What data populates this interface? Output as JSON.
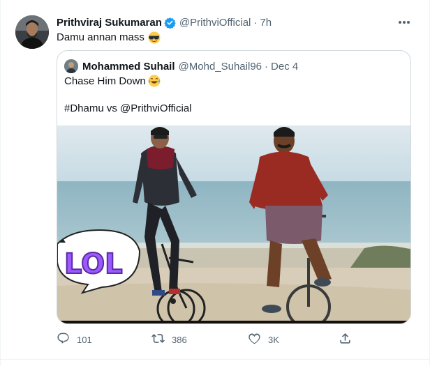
{
  "tweet": {
    "author_name": "Prithviraj Sukumaran",
    "author_handle": "@PrithviOfficial",
    "separator": "·",
    "time": "7h",
    "text": "Damu annan mass"
  },
  "quoted": {
    "author_name": "Mohammed Suhail",
    "author_handle": "@Mohd_Suhail96",
    "separator": "·",
    "time": "Dec 4",
    "text_line1": "Chase Him Down",
    "text_line2": "#Dhamu vs @PrithviOfficial",
    "sticker_text": "LOL"
  },
  "actions": {
    "replies": "101",
    "retweets": "386",
    "likes": "3K"
  },
  "icons": [
    "verified-badge-icon",
    "more-icon",
    "sunglasses-emoji-icon",
    "laughing-emoji-icon",
    "reply-icon",
    "retweet-icon",
    "like-icon",
    "share-icon"
  ],
  "colors": {
    "verified": "#1d9bf0",
    "secondary_text": "#536471",
    "border": "#cfd9de",
    "sticker": "#9b59ff"
  }
}
